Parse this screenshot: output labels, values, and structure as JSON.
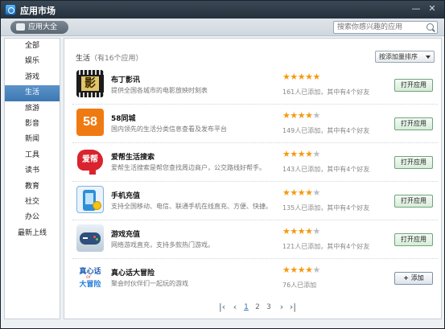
{
  "window": {
    "title": "应用市场",
    "minimize_glyph": "—",
    "close_glyph": "✕"
  },
  "toolbar": {
    "all_apps_tab": "应用大全",
    "search_placeholder": "搜索你感兴趣的应用"
  },
  "sidebar": {
    "items": [
      {
        "label": "全部"
      },
      {
        "label": "娱乐"
      },
      {
        "label": "游戏"
      },
      {
        "label": "生活",
        "active": true
      },
      {
        "label": "旅游"
      },
      {
        "label": "影音"
      },
      {
        "label": "新闻"
      },
      {
        "label": "工具"
      },
      {
        "label": "读书"
      },
      {
        "label": "教育"
      },
      {
        "label": "社交"
      },
      {
        "label": "办公"
      },
      {
        "label": "最新上线"
      }
    ]
  },
  "main": {
    "section_title": "生活",
    "section_count": "（有16个应用）",
    "sort_label": "按添加量排序",
    "apps": [
      {
        "name": "布丁影讯",
        "desc": "提供全国各城市的电影放映时刻表",
        "rating": 5,
        "added": "161人已添加，其中有4个好友",
        "button": "打开应用",
        "logo": "film-icon",
        "logo_text": "影"
      },
      {
        "name": "58同城",
        "desc": "国内领先的生活分类信息查看及发布平台",
        "rating": 4,
        "added": "149人已添加，其中有4个好友",
        "button": "打开应用",
        "logo": "58-logo",
        "logo_text": "58"
      },
      {
        "name": "爱帮生活搜索",
        "desc": "爱帮生活搜索是帮您查找周边商户，公交路线好帮手。",
        "rating": 4,
        "added": "143人已添加，其中有4个好友",
        "button": "打开应用",
        "logo": "aibang-logo",
        "logo_text": "爱帮"
      },
      {
        "name": "手机充值",
        "desc": "支持全国移动、电信、联通手机在线直充、方便、快捷。",
        "rating": 4,
        "added": "135人已添加，其中有4个好友",
        "button": "打开应用",
        "logo": "phone-recharge-icon",
        "logo_text": ""
      },
      {
        "name": "游戏充值",
        "desc": "网络游戏直充，支持多款热门游戏。",
        "rating": 4,
        "added": "121人已添加，其中有4个好友",
        "button": "打开应用",
        "logo": "gamepad-icon",
        "logo_text": ""
      },
      {
        "name": "真心话大冒险",
        "desc": "聚会时伙伴们一起玩的游戏",
        "rating": 4,
        "added": "76人已添加",
        "button": "添加",
        "logo": "truth-dare-logo",
        "logo_text_top": "真心话",
        "logo_text_mid": "or",
        "logo_text_bottom": "大冒险"
      }
    ]
  },
  "pager": {
    "first": "|‹",
    "prev": "‹",
    "pages": [
      "1",
      "2",
      "3"
    ],
    "current_page": "1",
    "next": "›",
    "last": "›|"
  }
}
